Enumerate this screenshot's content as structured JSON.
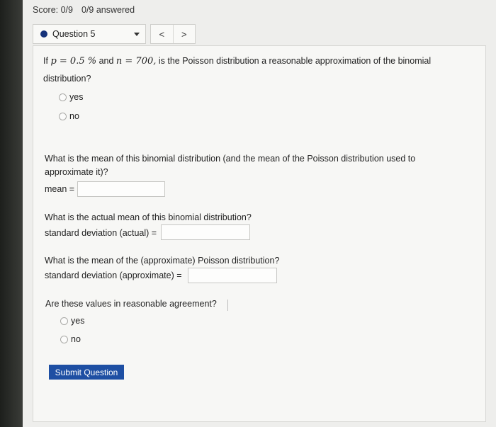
{
  "header": {
    "score": "Score: 0/9",
    "answered": "0/9 answered"
  },
  "question_selector": {
    "label": "Question 5",
    "prev": "<",
    "next": ">"
  },
  "question": {
    "prefix": "If",
    "p_expr": "p = 0.5 %",
    "and": "and",
    "n_expr": "n = 700,",
    "rest": "is the Poisson distribution a reasonable approximation of the binomial",
    "line2": "distribution?",
    "options": [
      "yes",
      "no"
    ]
  },
  "part_mean": {
    "line1": "What is the mean of this binomial distribution (and the mean of the Poisson distribution used to",
    "line2": "approximate it)?",
    "label": "mean =",
    "value": ""
  },
  "part_actual": {
    "line1": "What is the actual mean of this binomial distribution?",
    "label": "standard deviation (actual) =",
    "value": ""
  },
  "part_approx": {
    "line1": "What is the mean of the (approximate) Poisson distribution?",
    "label": "standard deviation (approximate) =",
    "value": ""
  },
  "agreement": {
    "question": "Are these values in reasonable agreement?",
    "options": [
      "yes",
      "no"
    ]
  },
  "submit_label": "Submit Question"
}
